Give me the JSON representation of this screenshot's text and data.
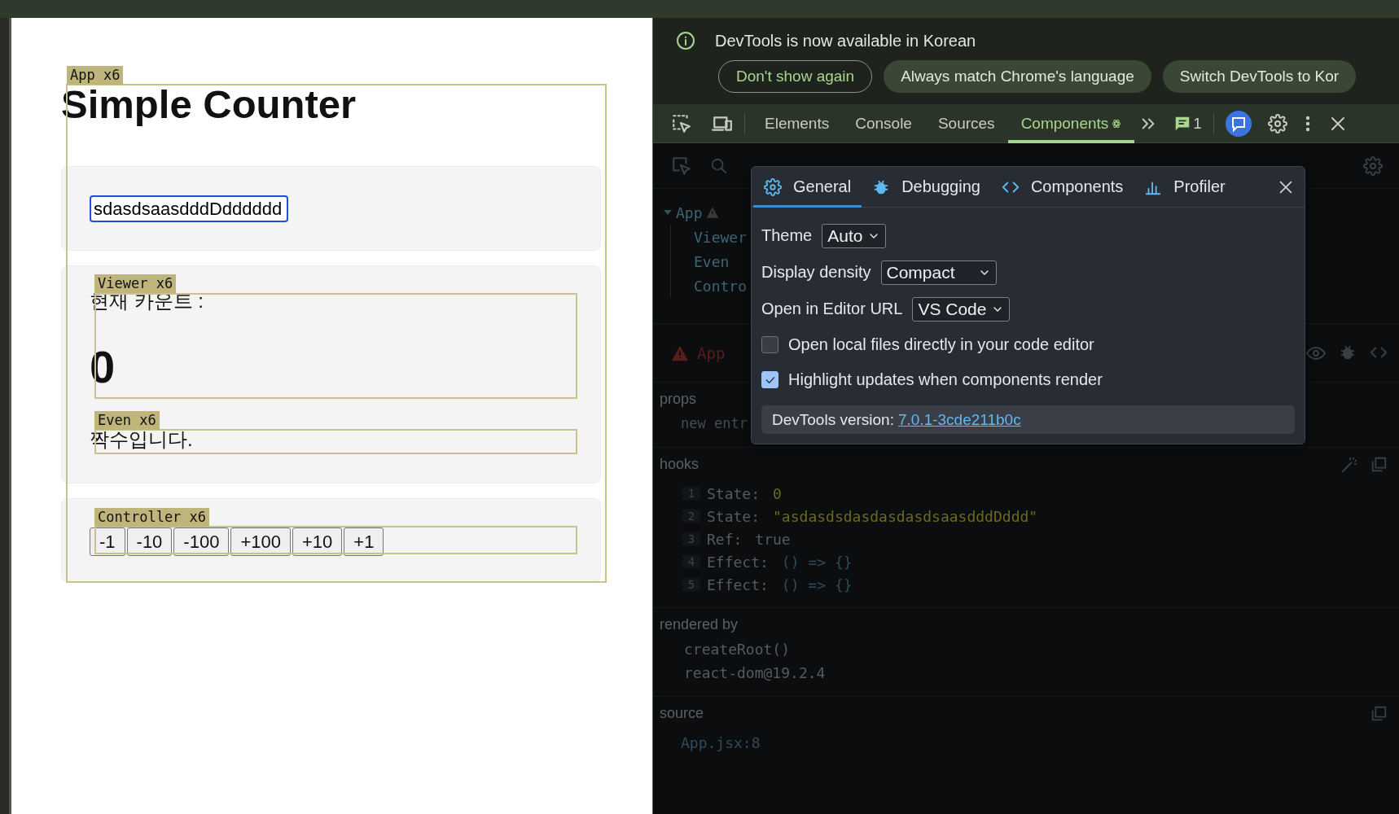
{
  "page": {
    "title": "Simple Counter",
    "input": {
      "value": "sdasdsaasdddDdddddd"
    },
    "viewer": {
      "label": "현재 카운트 :",
      "count": "0"
    },
    "even": {
      "text": "짝수입니다."
    },
    "buttons": [
      "-1",
      "-10",
      "-100",
      "+100",
      "+10",
      "+1"
    ],
    "highlights": [
      {
        "label": "App x6"
      },
      {
        "label": "Viewer x6"
      },
      {
        "label": "Even x6"
      },
      {
        "label": "Controller x6"
      }
    ]
  },
  "devtools": {
    "notice": {
      "message": "DevTools is now available in Korean",
      "actions": [
        {
          "label": "Don't show again",
          "kind": "outline"
        },
        {
          "label": "Always match Chrome's language",
          "kind": "filled"
        },
        {
          "label": "Switch DevTools to Kor",
          "kind": "filled"
        }
      ]
    },
    "tabs": [
      {
        "label": "Elements",
        "selected": false
      },
      {
        "label": "Console",
        "selected": false
      },
      {
        "label": "Sources",
        "selected": false
      },
      {
        "label": "Components",
        "selected": true
      }
    ],
    "message_count": "1",
    "tree": [
      {
        "label": "App",
        "expanded": true,
        "children": [
          {
            "label": "Viewer"
          },
          {
            "label": "Even"
          },
          {
            "label": "Contro"
          }
        ]
      }
    ],
    "selected_component": "App",
    "props": {
      "title": "props",
      "entries": [
        "new entr"
      ]
    },
    "hooks": {
      "title": "hooks",
      "rows": [
        {
          "index": "1",
          "name": "State:",
          "value": "0",
          "kind": "number"
        },
        {
          "index": "2",
          "name": "State:",
          "value": "\"asdasdsdasdasdasdsaasdddDddd\"",
          "kind": "string"
        },
        {
          "index": "3",
          "name": "Ref:",
          "value": "true",
          "kind": "boolean"
        },
        {
          "index": "4",
          "name": "Effect:",
          "value": "() => {}",
          "kind": "function"
        },
        {
          "index": "5",
          "name": "Effect:",
          "value": "() => {}",
          "kind": "function"
        }
      ]
    },
    "rendered_by": {
      "title": "rendered by",
      "items": [
        "createRoot()",
        "react-dom@19.2.4"
      ]
    },
    "source": {
      "title": "source",
      "location": "App.jsx:8"
    },
    "settings": {
      "tabs": [
        {
          "label": "General",
          "selected": true
        },
        {
          "label": "Debugging",
          "selected": false
        },
        {
          "label": "Components",
          "selected": false
        },
        {
          "label": "Profiler",
          "selected": false
        }
      ],
      "fields": [
        {
          "kind": "select",
          "label": "Theme",
          "value": "Auto"
        },
        {
          "kind": "select",
          "label": "Display density",
          "value": "Compact"
        },
        {
          "kind": "select",
          "label": "Open in Editor URL",
          "value": "VS Code"
        },
        {
          "kind": "checkbox",
          "label": "Open local files directly in your code editor",
          "checked": false
        },
        {
          "kind": "checkbox",
          "label": "Highlight updates when components render",
          "checked": true
        }
      ],
      "version_label": "DevTools version:",
      "version": "7.0.1-3cde211b0c"
    }
  }
}
